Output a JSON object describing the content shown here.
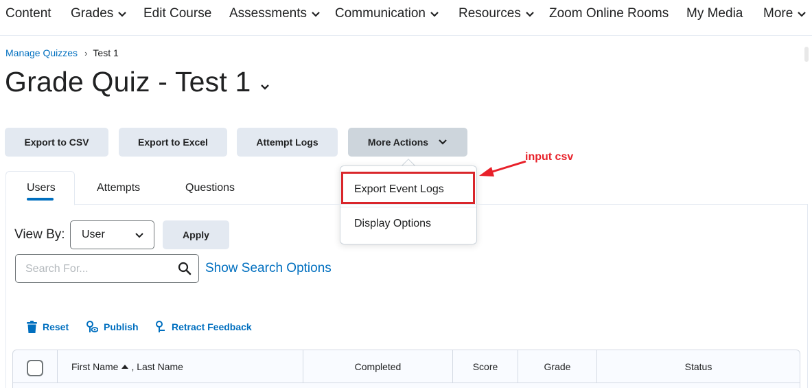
{
  "topnav": {
    "items": [
      {
        "label": "Content",
        "dropdown": false
      },
      {
        "label": "Grades",
        "dropdown": true
      },
      {
        "label": "Edit Course",
        "dropdown": false
      },
      {
        "label": "Assessments",
        "dropdown": true
      },
      {
        "label": "Communication",
        "dropdown": true
      },
      {
        "label": "Resources",
        "dropdown": true
      },
      {
        "label": "Zoom Online Rooms",
        "dropdown": false
      },
      {
        "label": "My Media",
        "dropdown": false
      },
      {
        "label": "More",
        "dropdown": true
      }
    ]
  },
  "breadcrumb": {
    "parent": "Manage Quizzes",
    "separator": "›",
    "current": "Test 1"
  },
  "page": {
    "title": "Grade Quiz - Test 1"
  },
  "toolbar": {
    "export_csv": "Export to CSV",
    "export_excel": "Export to Excel",
    "attempt_logs": "Attempt Logs",
    "more_actions": "More Actions"
  },
  "more_actions_menu": {
    "items": [
      "Export Event Logs",
      "Display Options"
    ]
  },
  "annotation": {
    "text": "input csv",
    "color": "#e8212a"
  },
  "tabs": [
    {
      "label": "Users",
      "active": true
    },
    {
      "label": "Attempts",
      "active": false
    },
    {
      "label": "Questions",
      "active": false
    }
  ],
  "filters": {
    "view_by_label": "View By:",
    "view_by_value": "User",
    "apply_label": "Apply",
    "search_placeholder": "Search For...",
    "search_options_label": "Show Search Options"
  },
  "actions": {
    "reset": "Reset",
    "publish": "Publish",
    "retract": "Retract Feedback"
  },
  "table": {
    "columns": {
      "name_first": "First Name",
      "name_sep": ", Last Name",
      "completed": "Completed",
      "score": "Score",
      "grade": "Grade",
      "status": "Status"
    }
  },
  "colors": {
    "accent": "#006fbf",
    "button_bg": "#e3e9f1",
    "highlight": "#d9262b"
  }
}
